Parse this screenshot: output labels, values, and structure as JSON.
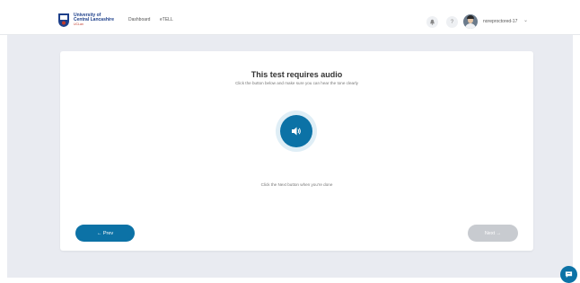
{
  "header": {
    "logo": {
      "line1": "University of",
      "line2": "Central Lancashire",
      "line3": "UCLan"
    },
    "nav": {
      "dashboard": "Dashboard",
      "etell": "eTELL"
    },
    "bell_icon": "bell-icon",
    "help_icon": "help-icon",
    "help_glyph": "?",
    "username": "noreproctored-17"
  },
  "card": {
    "title": "This test requires audio",
    "subtitle": "Click the button below and make sure you can hear the tone clearly",
    "audio_icon": "speaker-icon",
    "hint": "Click the Next button when you're done",
    "prev_label": "←   Prev",
    "next_label": "Next →"
  },
  "colors": {
    "primary": "#0c72a6",
    "disabled": "#c8cbd0",
    "background": "#e9ebf1"
  },
  "chat_icon": "chat-icon"
}
